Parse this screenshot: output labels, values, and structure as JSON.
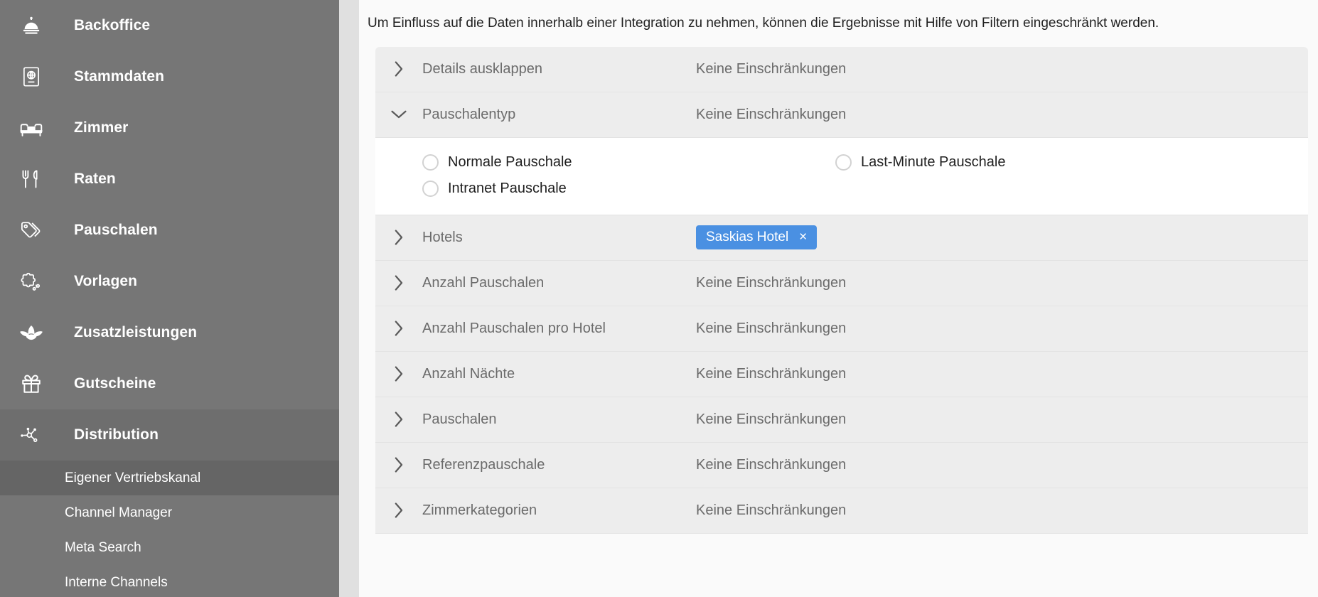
{
  "sidebar": {
    "items": [
      {
        "label": "Backoffice",
        "icon": "bell-icon",
        "active": false
      },
      {
        "label": "Stammdaten",
        "icon": "passport-icon",
        "active": false
      },
      {
        "label": "Zimmer",
        "icon": "bed-icon",
        "active": false
      },
      {
        "label": "Raten",
        "icon": "cutlery-icon",
        "active": false
      },
      {
        "label": "Pauschalen",
        "icon": "tag-icon",
        "active": false
      },
      {
        "label": "Vorlagen",
        "icon": "puzzle-icon",
        "active": false
      },
      {
        "label": "Zusatzleistungen",
        "icon": "lotus-icon",
        "active": false
      },
      {
        "label": "Gutscheine",
        "icon": "gift-icon",
        "active": false
      },
      {
        "label": "Distribution",
        "icon": "network-icon",
        "active": true
      }
    ],
    "subitems": [
      {
        "label": "Eigener Vertriebskanal",
        "active": true
      },
      {
        "label": "Channel Manager",
        "active": false
      },
      {
        "label": "Meta Search",
        "active": false
      },
      {
        "label": "Interne Channels",
        "active": false
      }
    ]
  },
  "main": {
    "intro": "Um Einfluss auf die Daten innerhalb einer Integration zu nehmen, können die Ergebnisse mit Hilfe von Filtern eingeschränkt werden.",
    "no_restriction_label": "Keine Einschränkungen",
    "rows": [
      {
        "label": "Details ausklappen",
        "value": "Keine Einschränkungen",
        "expanded": false,
        "icon": "chevron-right-icon"
      },
      {
        "label": "Pauschalentyp",
        "value": "Keine Einschränkungen",
        "expanded": true,
        "icon": "chevron-down-icon"
      },
      {
        "label": "Hotels",
        "value": "",
        "expanded": false,
        "icon": "chevron-right-icon",
        "chip": "Saskias Hotel"
      },
      {
        "label": "Anzahl Pauschalen",
        "value": "Keine Einschränkungen",
        "expanded": false,
        "icon": "chevron-right-icon"
      },
      {
        "label": "Anzahl Pauschalen pro Hotel",
        "value": "Keine Einschränkungen",
        "expanded": false,
        "icon": "chevron-right-icon"
      },
      {
        "label": "Anzahl Nächte",
        "value": "Keine Einschränkungen",
        "expanded": false,
        "icon": "chevron-right-icon"
      },
      {
        "label": "Pauschalen",
        "value": "Keine Einschränkungen",
        "expanded": false,
        "icon": "chevron-right-icon"
      },
      {
        "label": "Referenzpauschale",
        "value": "Keine Einschränkungen",
        "expanded": false,
        "icon": "chevron-right-icon"
      },
      {
        "label": "Zimmerkategorien",
        "value": "Keine Einschränkungen",
        "expanded": false,
        "icon": "chevron-right-icon"
      }
    ],
    "pauschalentyp_options": [
      {
        "label": "Normale Pauschale",
        "selected": false
      },
      {
        "label": "Last-Minute Pauschale",
        "selected": false
      },
      {
        "label": "Intranet Pauschale",
        "selected": false
      }
    ],
    "chip_close_glyph": "×"
  },
  "colors": {
    "sidebar_bg": "#767676",
    "sidebar_active": "#6e6e6e",
    "subitem_active": "#656565",
    "row_bg": "#ededed",
    "chip_blue": "#4a90e2",
    "page_bg": "#fafafa",
    "gutter": "#e0e0e0"
  }
}
